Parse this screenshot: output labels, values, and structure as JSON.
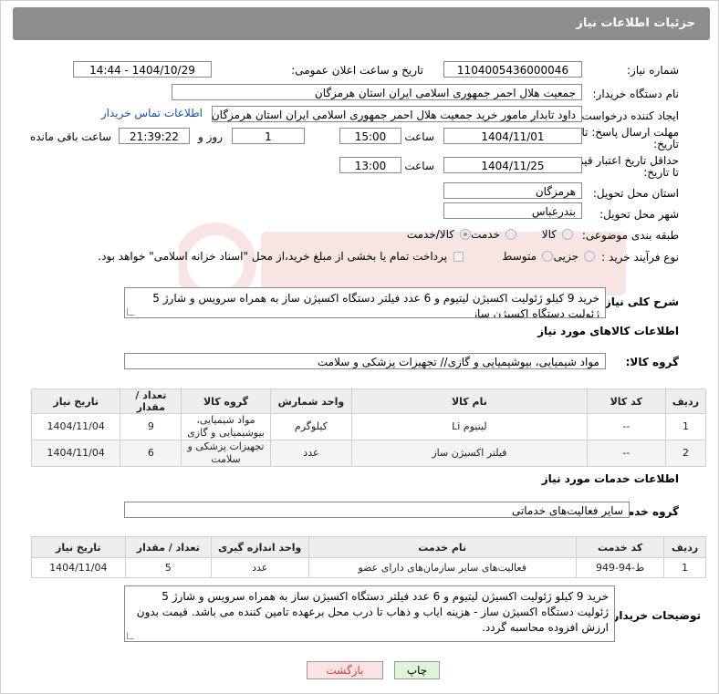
{
  "header": {
    "title": "جزئیات اطلاعات نیاز"
  },
  "form": {
    "need_number_label": "شماره نیاز:",
    "need_number": "1104005436000046",
    "announce_label": "تاریخ و ساعت اعلان عمومی:",
    "announce_value": "1404/10/29 - 14:44",
    "buyer_org_label": "نام دستگاه خریدار:",
    "buyer_org": "جمعیت هلال احمر جمهوری اسلامی ایران استان هرمزگان",
    "creator_label": "ایجاد کننده درخواست:",
    "creator": "داود تابدار مامور خرید جمعیت هلال احمر جمهوری اسلامی ایران استان هرمزگان",
    "contact_link": "اطلاعات تماس خریدار",
    "reply_label_1": "مهلت ارسال پاسخ: تا",
    "reply_label_2": "تاریخ:",
    "reply_date": "1404/11/01",
    "time_label": "ساعت",
    "reply_time": "15:00",
    "days_value": "1",
    "days_label": "روز و",
    "remaining_time": "21:39:22",
    "remaining_label": "ساعت باقی مانده",
    "validity_label_1": "حداقل تاریخ اعتبار قیمت:",
    "validity_label_2": "تا تاریخ:",
    "validity_date": "1404/11/25",
    "validity_time": "13:00",
    "province_label": "استان محل تحویل:",
    "province": "هرمزگان",
    "city_label": "شهر محل تحویل:",
    "city": "بندرعباس",
    "category_label": "طبقه بندی موضوعی:",
    "category_options": [
      "کالا",
      "خدمت",
      "کالا/خدمت"
    ],
    "category_selected": "کالا/خدمت",
    "process_label": "نوع فرآیند خرید :",
    "process_options": [
      "جزیی",
      "متوسط"
    ],
    "payment_note": "پرداخت تمام یا بخشی از مبلغ خرید،از محل \"اسناد خزانه اسلامی\" خواهد بود.",
    "description_label": "شرح کلی نیاز:",
    "description": "خرید 9 کیلو ژئولیت اکسیژن لیتیوم و 6 عدد فیلتر دستگاه اکسیژن ساز به همراه سرویس و شارژ 5 ژئولیت دستگاه اکسیژن ساز"
  },
  "goods": {
    "section_title": "اطلاعات کالاهای مورد نیاز",
    "group_label": "گروه کالا:",
    "group_value": "مواد شیمیایی، بیوشیمیایی و گازی// تجهیزات پزشکی و سلامت",
    "columns": [
      "ردیف",
      "کد کالا",
      "نام کالا",
      "واحد شمارش",
      "گروه کالا",
      "تعداد / مقدار",
      "تاریخ نیاز"
    ],
    "rows": [
      [
        "1",
        "--",
        "لیتیوم Li",
        "کیلوگرم",
        "مواد شیمیایی، بیوشیمیایی و گازی",
        "9",
        "1404/11/04"
      ],
      [
        "2",
        "--",
        "فیلتر اکسیژن ساز",
        "عدد",
        "تجهیزات پزشکی و سلامت",
        "6",
        "1404/11/04"
      ]
    ]
  },
  "services": {
    "section_title": "اطلاعات خدمات مورد نیاز",
    "group_label": "گروه خدمت:",
    "group_value": "سایر فعالیت‌های خدماتی",
    "columns": [
      "ردیف",
      "کد خدمت",
      "نام خدمت",
      "واحد اندازه گیری",
      "تعداد / مقدار",
      "تاریخ نیاز"
    ],
    "rows": [
      [
        "1",
        "ط-94-949",
        "فعالیت‌های سایر سازمان‌های دارای عضو",
        "عدد",
        "5",
        "1404/11/04"
      ]
    ]
  },
  "buyer_notes": {
    "label": "توضیحات خریدار:",
    "text": "خرید 9 کیلو ژئولیت اکسیژن لیتیوم و 6 عدد فیلتر دستگاه اکسیژن ساز به همراه سرویس و شارژ 5 ژئولیت دستگاه اکسیژن ساز - هزینه ایاب و ذهاب تا درب محل برعهده تامین کننده می باشد. قیمت بدون ارزش افزوده محاسبه گردد."
  },
  "buttons": {
    "print": "چاپ",
    "back": "بازگشت"
  },
  "colors": {
    "header_bg": "#8d8d8d",
    "print_bg": "#dff5d8",
    "back_bg": "#fbe3e3",
    "link": "#1a4ea0"
  }
}
